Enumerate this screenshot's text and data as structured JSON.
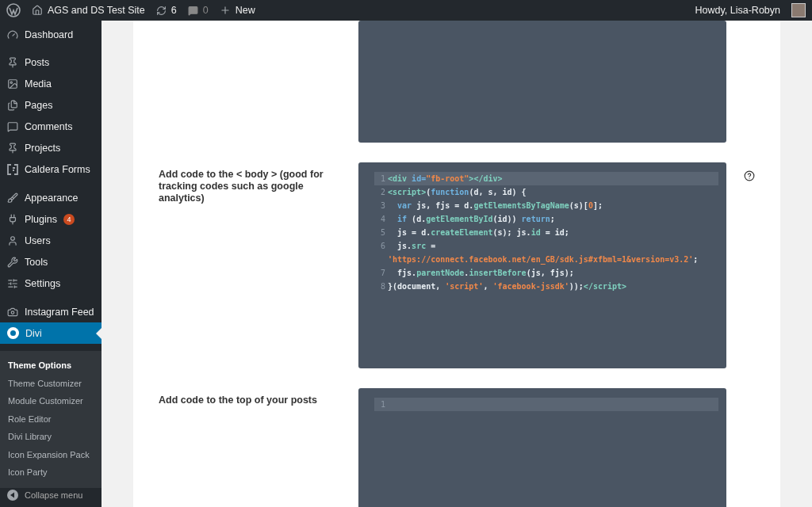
{
  "admin_bar": {
    "site_name": "AGS and DS Test Site",
    "updates_count": "6",
    "comments_count": "0",
    "new_label": "New",
    "greeting": "Howdy, Lisa-Robyn"
  },
  "sidebar": {
    "groups": [
      [
        {
          "label": "Dashboard",
          "selected": false
        }
      ],
      [
        {
          "label": "Posts",
          "selected": false
        },
        {
          "label": "Media",
          "selected": false
        },
        {
          "label": "Pages",
          "selected": false
        },
        {
          "label": "Comments",
          "selected": false
        },
        {
          "label": "Projects",
          "selected": false
        },
        {
          "label": "Caldera Forms",
          "selected": false
        }
      ],
      [
        {
          "label": "Appearance",
          "selected": false
        },
        {
          "label": "Plugins",
          "selected": false,
          "badge": "4"
        },
        {
          "label": "Users",
          "selected": false
        },
        {
          "label": "Tools",
          "selected": false
        },
        {
          "label": "Settings",
          "selected": false
        }
      ],
      [
        {
          "label": "Instagram Feed",
          "selected": false
        },
        {
          "label": "Divi",
          "selected": true
        }
      ]
    ],
    "submenu": [
      {
        "label": "Theme Options",
        "selected": true
      },
      {
        "label": "Theme Customizer",
        "selected": false
      },
      {
        "label": "Module Customizer",
        "selected": false
      },
      {
        "label": "Role Editor",
        "selected": false
      },
      {
        "label": "Divi Library",
        "selected": false
      },
      {
        "label": "Icon Expansion Pack",
        "selected": false
      },
      {
        "label": "Icon Party",
        "selected": false
      }
    ],
    "collapse_label": "Collapse menu"
  },
  "settings": [
    {
      "kind": "editor-only"
    },
    {
      "kind": "labeled",
      "label": "Add code to the < body > (good for tracking codes such as google analytics)",
      "help": true,
      "lines": [
        {
          "number": "1",
          "active": true,
          "tokens": [
            {
              "t": "<div ",
              "kind": "tag"
            },
            {
              "t": "id=",
              "kind": "attr"
            },
            {
              "t": "\"fb-root\"",
              "kind": "string"
            },
            {
              "t": "></div>",
              "kind": "tag"
            }
          ]
        },
        {
          "number": "2",
          "active": false,
          "tokens": [
            {
              "t": "<script>",
              "kind": "tag"
            },
            {
              "t": "(",
              "kind": "plain"
            },
            {
              "t": "function",
              "kind": "keyword"
            },
            {
              "t": "(d, s, id) {",
              "kind": "plain"
            }
          ]
        },
        {
          "number": "3",
          "active": false,
          "tokens": [
            {
              "t": "  var ",
              "kind": "keyword"
            },
            {
              "t": "js, fjs = d.",
              "kind": "plain"
            },
            {
              "t": "getElementsByTagName",
              "kind": "tag"
            },
            {
              "t": "(s)[",
              "kind": "plain"
            },
            {
              "t": "0",
              "kind": "string"
            },
            {
              "t": "];",
              "kind": "plain"
            }
          ]
        },
        {
          "number": "4",
          "active": false,
          "tokens": [
            {
              "t": "  if ",
              "kind": "keyword"
            },
            {
              "t": "(d.",
              "kind": "plain"
            },
            {
              "t": "getElementById",
              "kind": "tag"
            },
            {
              "t": "(id)) ",
              "kind": "plain"
            },
            {
              "t": "return",
              "kind": "keyword"
            },
            {
              "t": ";",
              "kind": "plain"
            }
          ]
        },
        {
          "number": "5",
          "active": false,
          "tokens": [
            {
              "t": "  js = d.",
              "kind": "plain"
            },
            {
              "t": "createElement",
              "kind": "tag"
            },
            {
              "t": "(s); js.",
              "kind": "plain"
            },
            {
              "t": "id",
              "kind": "tag"
            },
            {
              "t": " = id;",
              "kind": "plain"
            }
          ]
        },
        {
          "number": "6",
          "active": false,
          "tokens": [
            {
              "t": "  js.",
              "kind": "plain"
            },
            {
              "t": "src",
              "kind": "tag"
            },
            {
              "t": " =",
              "kind": "plain"
            }
          ]
        },
        {
          "active": false,
          "tokens": [
            {
              "t": "'https://connect.facebook.net/en_GB/sdk.js#xfbml=1&version=v3.2'",
              "kind": "string"
            },
            {
              "t": ";",
              "kind": "plain"
            }
          ]
        },
        {
          "number": "7",
          "active": false,
          "tokens": [
            {
              "t": "  fjs.",
              "kind": "plain"
            },
            {
              "t": "parentNode",
              "kind": "tag"
            },
            {
              "t": ".",
              "kind": "plain"
            },
            {
              "t": "insertBefore",
              "kind": "tag"
            },
            {
              "t": "(js, fjs);",
              "kind": "plain"
            }
          ]
        },
        {
          "number": "8",
          "active": false,
          "tokens": [
            {
              "t": "}(document, ",
              "kind": "plain"
            },
            {
              "t": "'script'",
              "kind": "string"
            },
            {
              "t": ", ",
              "kind": "plain"
            },
            {
              "t": "'facebook-jssdk'",
              "kind": "string"
            },
            {
              "t": "));",
              "kind": "plain"
            },
            {
              "t": "</script>",
              "kind": "tag"
            }
          ]
        }
      ]
    },
    {
      "kind": "labeled",
      "label": "Add code to the top of your posts",
      "lines": [
        {
          "number": "1",
          "active": true
        }
      ]
    }
  ]
}
